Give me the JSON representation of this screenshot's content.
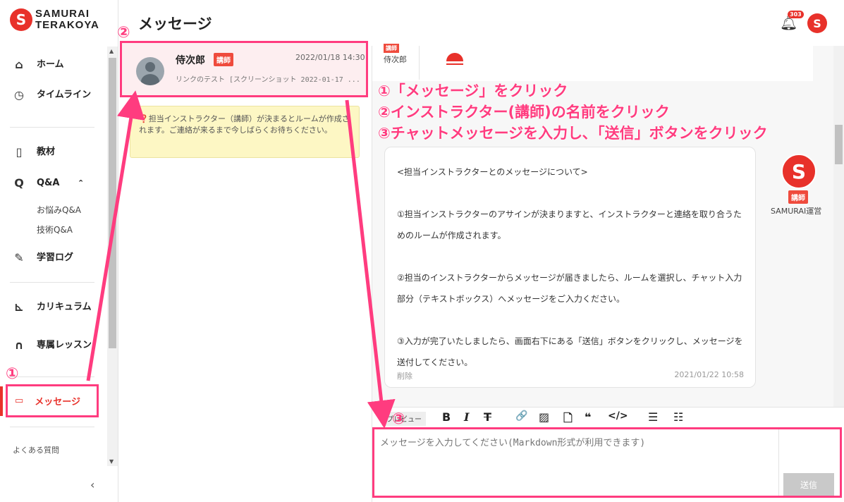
{
  "brand": {
    "logo_line1": "SAMURAI",
    "logo_line2": "TERAKOYA",
    "logo_mark": "S"
  },
  "header": {
    "title": "メッセージ",
    "notification_count": "303",
    "avatar_mark": "S"
  },
  "sidebar": {
    "items": [
      {
        "icon": "home-icon",
        "label": "ホーム"
      },
      {
        "icon": "clock-icon",
        "label": "タイムライン"
      },
      {
        "icon": "book-icon",
        "label": "教材"
      },
      {
        "icon": "search-icon",
        "label": "Q&A"
      },
      {
        "icon": "pencil-icon",
        "label": "学習ログ"
      },
      {
        "icon": "chart-icon",
        "label": "カリキュラム"
      },
      {
        "icon": "headset-icon",
        "label": "専属レッスン"
      }
    ],
    "qa_sub": [
      "お悩みQ&A",
      "技術Q&A"
    ],
    "active_label": "メッセージ",
    "faq": "よくある質問"
  },
  "steps": {
    "s1": "①",
    "s2": "②",
    "s3": "③"
  },
  "room": {
    "name": "侍次郎",
    "badge": "講師",
    "time": "2022/01/18 14:30",
    "preview": "リンクのテスト [スクリーンショット 2022-01-17 ..."
  },
  "notice": "❓担当インストラクター（講師）が決まるとルームが作成されます。ご連絡が来るまで今しばらくお待ちください。",
  "chat": {
    "prev_badge": "講師",
    "prev_name": "侍次郎",
    "annotations": [
      "①「メッセージ」をクリック",
      "②インストラクター(講師)の名前をクリック",
      "③チャットメッセージを入力し､「送信」ボタンをクリック"
    ],
    "message": "<担当インストラクターとのメッセージについて>\n\n①担当インストラクターのアサインが決まりますと、インストラクターと連絡を取り合うためのルームが作成されます。\n\n②担当のインストラクターからメッセージが届きましたら、ルームを選択し、チャット入力部分（テキストボックス）へメッセージをご入力ください。\n\n③入力が完了いたしましたら、画面右下にある「送信」ボタンをクリックし、メッセージを送付してください。",
    "delete_label": "削除",
    "date": "2021/01/22 10:58",
    "sender_badge": "講師",
    "sender_name": "SAMURAI運営",
    "sender_mark": "S"
  },
  "toolbar": {
    "preview_label": "プレビュー",
    "bold": "B",
    "italic": "I",
    "strike": "T",
    "link": "🔗",
    "image": "▨",
    "file": "🗋",
    "quote": "❝",
    "code": "</>",
    "ul": "☰",
    "ol": "☷"
  },
  "composer": {
    "placeholder": "メッセージを入力してください(Markdown形式が利用できます)",
    "send_label": "送信"
  },
  "colors": {
    "accent": "#e8312a",
    "annotation": "#ff3c7f"
  }
}
